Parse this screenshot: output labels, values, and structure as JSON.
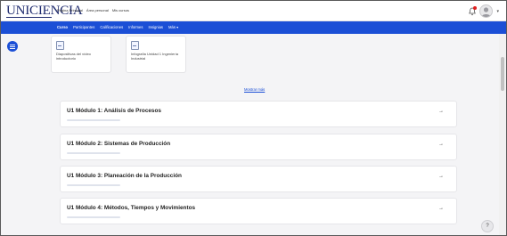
{
  "header": {
    "logo": "UNICIENCIA",
    "nav": [
      "Página Principal",
      "Área personal",
      "Mis cursos"
    ]
  },
  "course_nav": {
    "items": [
      "Curso",
      "Participantes",
      "Calificaciones",
      "Informes",
      "Insignias",
      "Más ▾"
    ],
    "active_index": 0
  },
  "resources": [
    {
      "label": "Diapositivas del vídeo introductorio"
    },
    {
      "label": "Infografía Unidad 1 Ingeniería Industrial"
    }
  ],
  "show_more": "Mostrar más",
  "modules": [
    {
      "title": "U1 Módulo 1: Análisis de Procesos"
    },
    {
      "title": "U1 Módulo 2: Sistemas de Producción"
    },
    {
      "title": "U1 Módulo 3: Planeación de la Producción"
    },
    {
      "title": "U1 Módulo 4: Métodos, Tiempos y Movimientos"
    }
  ],
  "help_label": "?",
  "colors": {
    "accent": "#1b4fd6",
    "logo": "#1f2b6e",
    "notification": "#e02020"
  },
  "icons": [
    "bell-icon",
    "user-avatar-icon",
    "chevron-down-icon",
    "drawer-toggle-icon",
    "file-icon",
    "arrow-right-icon",
    "help-icon"
  ]
}
